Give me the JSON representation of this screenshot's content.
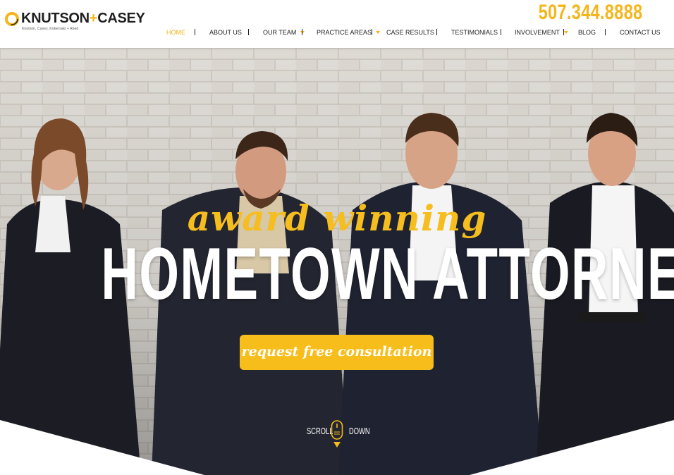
{
  "brand": {
    "name_left": "KNUTSON",
    "plus": "+",
    "name_right": "CASEY",
    "subline": "Knutson, Casey, Kobersaki + Abed",
    "logo_icon": "ring-logo-icon"
  },
  "phone": "507.344.8888",
  "nav": {
    "items": [
      {
        "label": "HOME",
        "active": true,
        "dropdown": false
      },
      {
        "label": "ABOUT US",
        "active": false,
        "dropdown": false
      },
      {
        "label": "OUR TEAM",
        "active": false,
        "dropdown": true
      },
      {
        "label": "PRACTICE AREAS",
        "active": false,
        "dropdown": true
      },
      {
        "label": "CASE RESULTS",
        "active": false,
        "dropdown": false
      },
      {
        "label": "TESTIMONIALS",
        "active": false,
        "dropdown": false
      },
      {
        "label": "INVOLVEMENT",
        "active": false,
        "dropdown": true
      },
      {
        "label": "BLOG",
        "active": false,
        "dropdown": false
      },
      {
        "label": "CONTACT US",
        "active": false,
        "dropdown": false
      }
    ]
  },
  "hero": {
    "tagline": "award winning",
    "headline": "HOMETOWN ATTORNEYS",
    "cta": "request free consultation",
    "scroll_left": "SCROLL",
    "scroll_right": "DOWN",
    "scroll_icon": "mouse-scroll-icon"
  },
  "colors": {
    "accent": "#f5b51b",
    "text": "#222222",
    "background": "#ffffff"
  }
}
